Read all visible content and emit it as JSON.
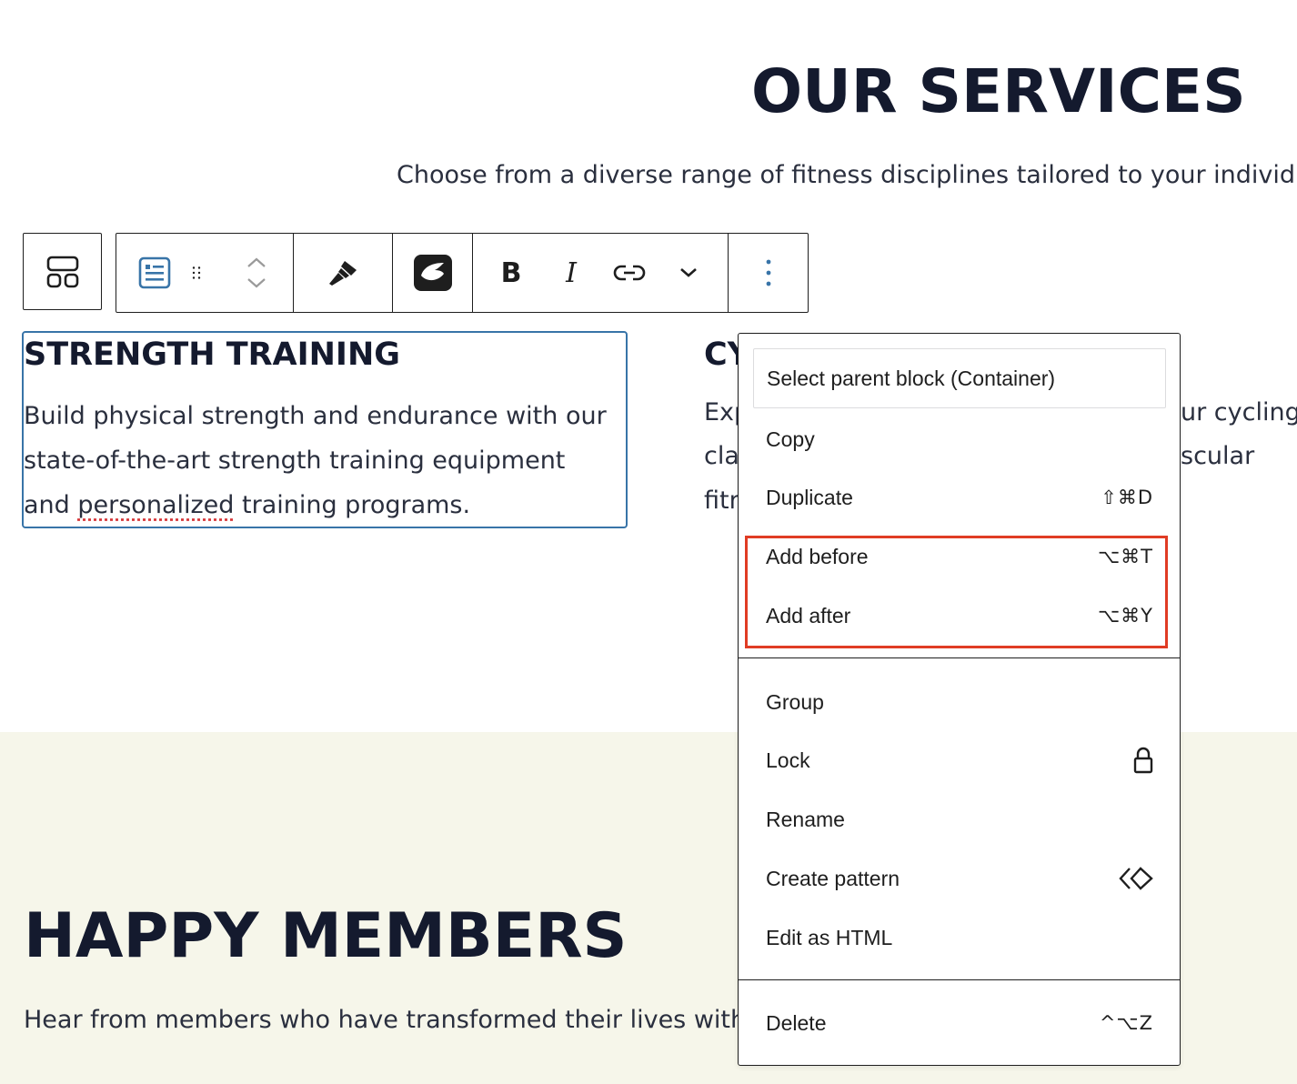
{
  "services": {
    "title": "OUR SERVICES",
    "subtitle": "Choose from a diverse range of fitness disciplines tailored to your individu"
  },
  "card_strength": {
    "title": "STRENGTH TRAINING",
    "line1": "Build physical strength and endurance with our",
    "line2": "state-of-the-art strength training equipment",
    "line3_pre": "and ",
    "line3_spell": "personalized",
    "line3_post": " training programs."
  },
  "card_cycling": {
    "title_partial": "CY",
    "line1_left": "Exp",
    "line1_right": "ur cycling",
    "line2_left": "cla",
    "line2_right": "scular",
    "line3_left": "fitn"
  },
  "toolbar": {
    "parent_icon": "layout-grid-icon",
    "block_icon": "paragraph-block-icon",
    "drag_icon": "drag-handle-icon",
    "move_up_icon": "chevron-up-icon",
    "move_down_icon": "chevron-down-icon",
    "style_icon": "paintbrush-icon",
    "plugin_icon": "plugin-logo-icon",
    "bold_label": "B",
    "italic_label": "I",
    "link_icon": "link-icon",
    "more_icon": "chevron-down-icon",
    "options_icon": "more-vertical-icon"
  },
  "menu": {
    "select_parent": "Select parent block (Container)",
    "copy": "Copy",
    "duplicate": "Duplicate",
    "duplicate_shortcut": "⇧⌘D",
    "add_before": "Add before",
    "add_before_shortcut": "⌥⌘T",
    "add_after": "Add after",
    "add_after_shortcut": "⌥⌘Y",
    "group": "Group",
    "lock": "Lock",
    "lock_icon": "lock-icon",
    "rename": "Rename",
    "create_pattern": "Create pattern",
    "create_pattern_icon": "pattern-diamond-icon",
    "edit_html": "Edit as HTML",
    "delete": "Delete",
    "delete_shortcut": "^⌥Z"
  },
  "happy": {
    "title": "HAPPY MEMBERS",
    "subtitle": "Hear from members who have transformed their lives with"
  },
  "colors": {
    "heading": "#141a2e",
    "band": "#f6f6ea",
    "selection_blue": "#3874a8",
    "highlight_red": "#e03c24"
  }
}
